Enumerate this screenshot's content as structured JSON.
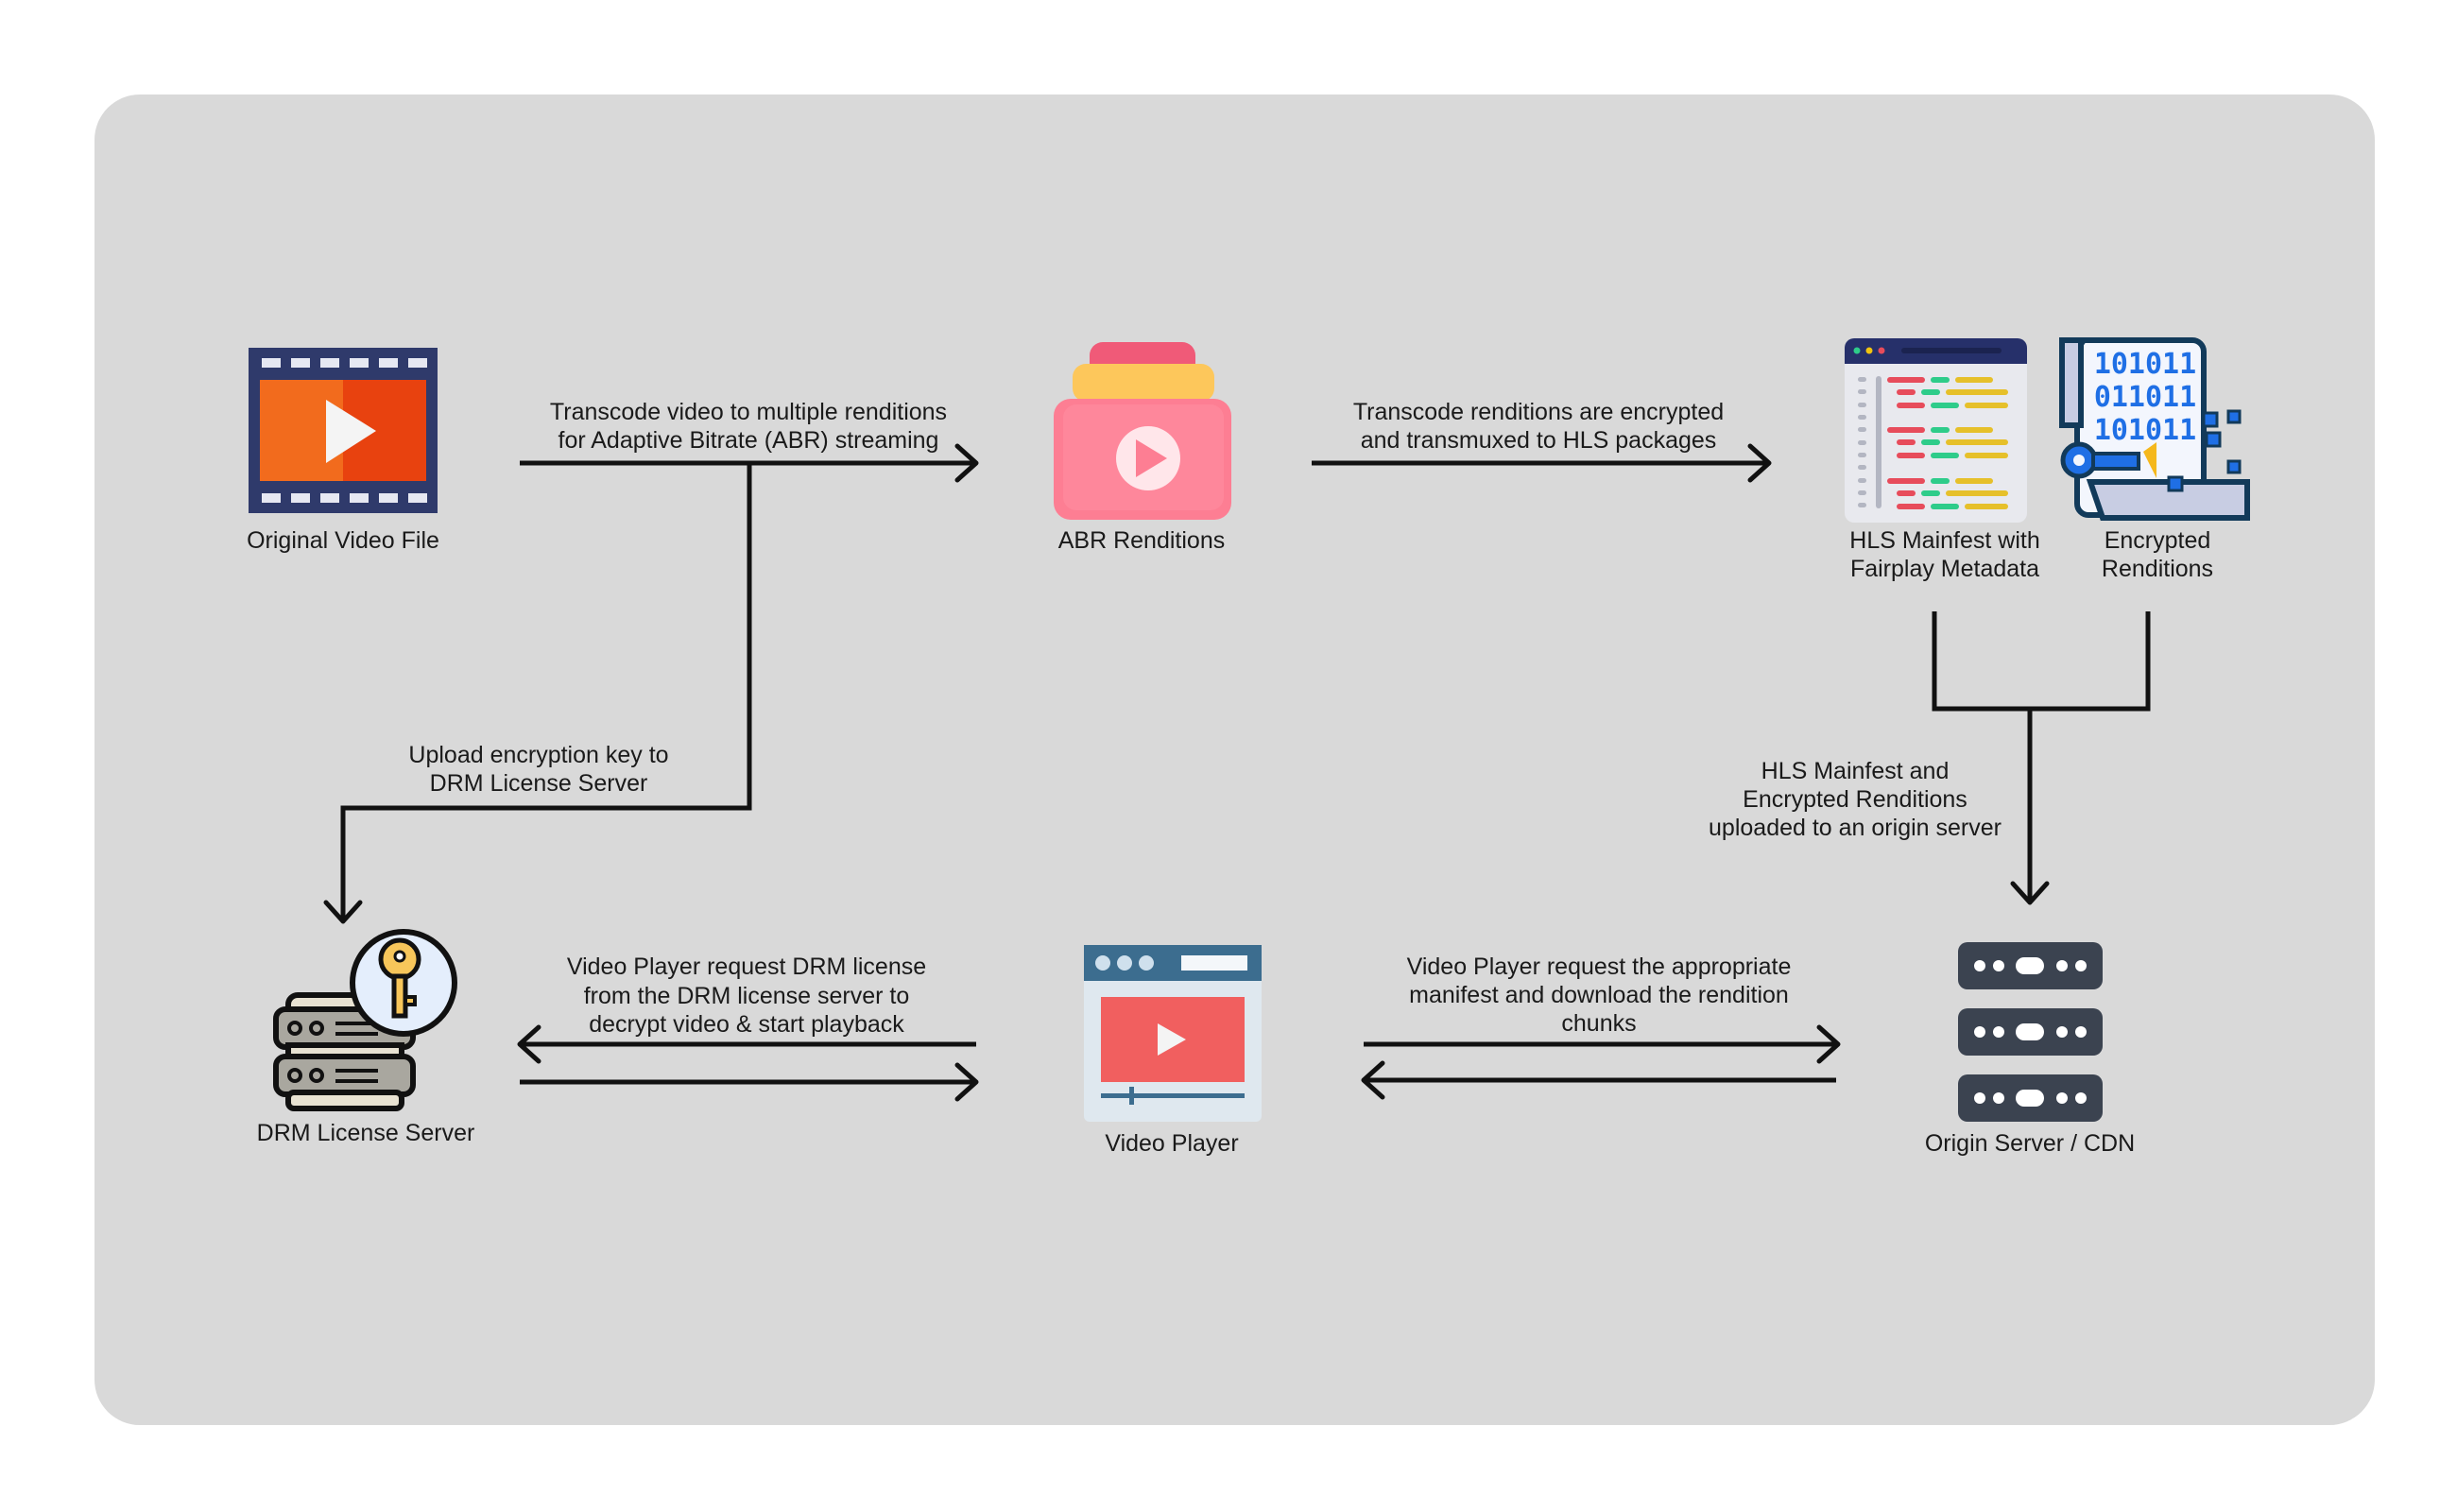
{
  "colors": {
    "background": "#ffffff",
    "panel": "#d9d9d9",
    "line": "#111111"
  },
  "nodes": {
    "original": {
      "label": [
        "Original Video File"
      ],
      "icon": "film-play-icon"
    },
    "abr": {
      "label": [
        "ABR Renditions"
      ],
      "icon": "stacked-video-icon"
    },
    "hls": {
      "label": [
        "HLS Mainfest with",
        "Fairplay Metadata"
      ],
      "icon": "code-window-icon"
    },
    "encrypted": {
      "label": [
        "Encrypted",
        "Renditions"
      ],
      "icon": "binary-scroll-key-icon"
    },
    "origin": {
      "label": [
        "Origin Server / CDN"
      ],
      "icon": "server-stack-icon"
    },
    "player": {
      "label": [
        "Video Player"
      ],
      "icon": "video-player-window-icon"
    },
    "drm": {
      "label": [
        "DRM License Server"
      ],
      "icon": "server-key-icon"
    }
  },
  "edges": {
    "transcode": [
      "Transcode video to multiple renditions",
      "for Adaptive Bitrate (ABR) streaming"
    ],
    "encrypt": [
      "Transcode renditions are encrypted",
      "and transmuxed to HLS packages"
    ],
    "upload_key": [
      "Upload encryption key to",
      "DRM License Server"
    ],
    "upload_origin": [
      "HLS Mainfest and",
      "Encrypted Renditions",
      "uploaded to an origin server"
    ],
    "license": [
      "Video Player request DRM license",
      "from the DRM license server to",
      "decrypt video & start playback"
    ],
    "manifest": [
      "Video Player request the appropriate",
      "manifest and download the rendition",
      "chunks"
    ]
  }
}
